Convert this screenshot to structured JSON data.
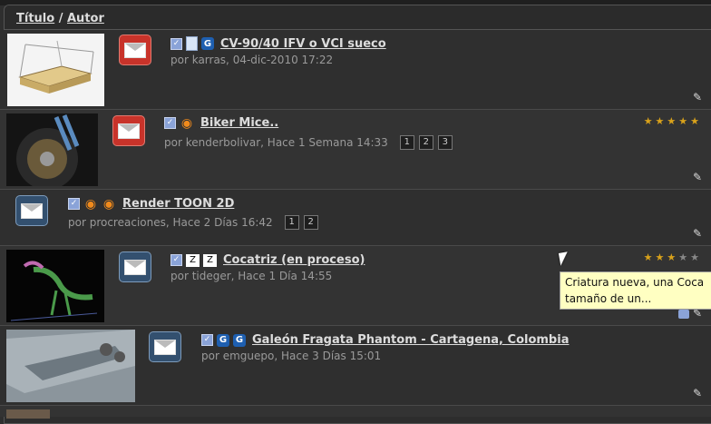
{
  "header": {
    "titulo": "Título",
    "sep": "/",
    "autor": "Autor"
  },
  "rows": [
    {
      "title": "CV-90/40 IFV o VCI sueco",
      "byline": "por karras, 04-dic-2010 17:22",
      "icons": [
        "checkbox",
        "document-icon",
        "cinema4d-icon"
      ],
      "pages": [],
      "rating": 0
    },
    {
      "title": "Biker Mice..",
      "byline": "por kenderbolivar, Hace 1 Semana 14:33",
      "icons": [
        "checkbox",
        "blender-icon"
      ],
      "pages": [
        "1",
        "2",
        "3"
      ],
      "rating": 5
    },
    {
      "title": "Render TOON 2D",
      "byline": "por procreaciones, Hace 2 Días 16:42",
      "icons": [
        "checkbox",
        "blender-icon",
        "blender-icon"
      ],
      "pages": [
        "1",
        "2"
      ],
      "rating": 0
    },
    {
      "title": "Cocatriz (en proceso)",
      "byline": "por tideger, Hace 1 Día 14:55",
      "icons": [
        "checkbox",
        "zbrush-icon",
        "zbrush-icon"
      ],
      "pages": [],
      "rating": 3
    },
    {
      "title": "Galeón Fragata Phantom - Cartagena, Colombia",
      "byline": "por emguepo, Hace 3 Días 15:01",
      "icons": [
        "checkbox",
        "cinema4d-icon",
        "cinema4d-icon"
      ],
      "pages": [],
      "rating": 0
    }
  ],
  "tooltip": {
    "line1": "Criatura nueva, una Coca",
    "line2": "tamaño de un..."
  },
  "colors": {
    "background": "#2f2f2f",
    "star": "#d9a21b",
    "mail_red": "#c8332a",
    "mail_blue": "#33506f",
    "tooltip_bg": "#ffffc2"
  }
}
